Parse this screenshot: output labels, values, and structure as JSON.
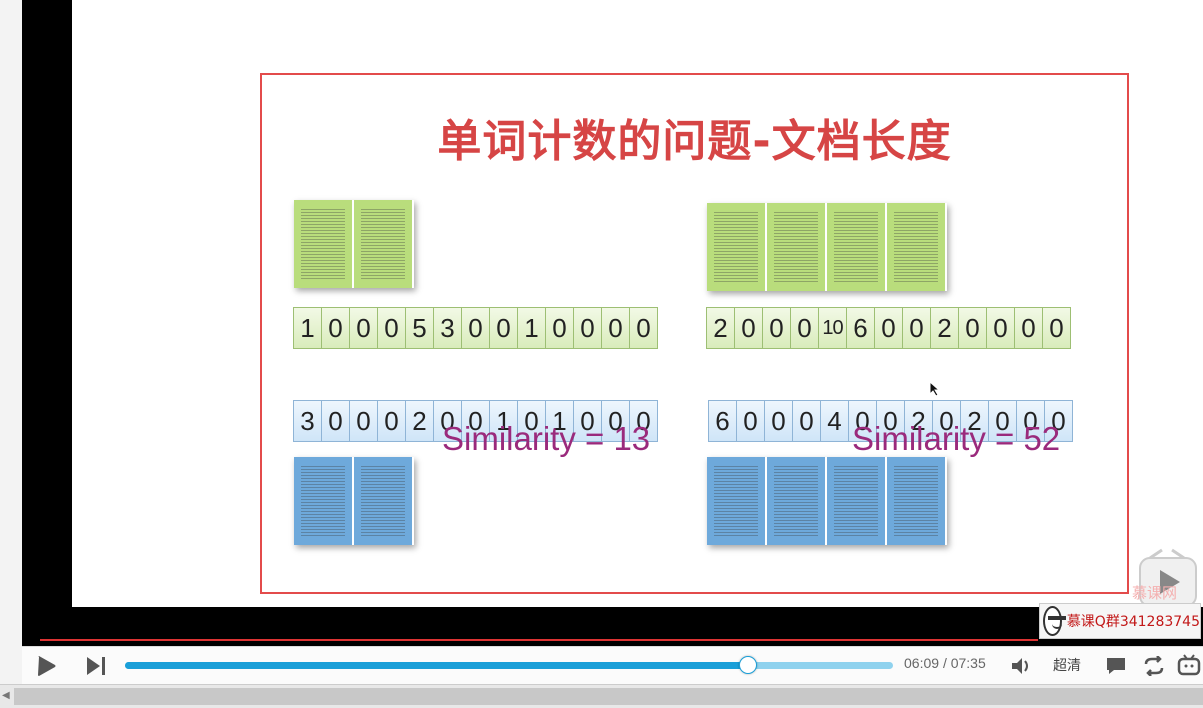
{
  "slide": {
    "title": "单词计数的问题-文档长度",
    "left": {
      "doc_top_vector": [
        "1",
        "0",
        "0",
        "0",
        "5",
        "3",
        "0",
        "0",
        "1",
        "0",
        "0",
        "0",
        "0"
      ],
      "doc_bottom_vector": [
        "3",
        "0",
        "0",
        "0",
        "2",
        "0",
        "0",
        "1",
        "0",
        "1",
        "0",
        "0",
        "0"
      ],
      "similarity": "Similarity = 13"
    },
    "right": {
      "doc_top_vector": [
        "2",
        "0",
        "0",
        "0",
        "10",
        "6",
        "0",
        "0",
        "2",
        "0",
        "0",
        "0",
        "0"
      ],
      "doc_bottom_vector": [
        "6",
        "0",
        "0",
        "0",
        "4",
        "0",
        "0",
        "2",
        "0",
        "2",
        "0",
        "0",
        "0"
      ],
      "similarity": "Similarity = 52"
    }
  },
  "watermark": {
    "brand": "慕课网",
    "qq_group": "慕课Q群341283745"
  },
  "player": {
    "progress": 0.81,
    "current_time": "06:09",
    "separator": "/",
    "total_time": "07:35",
    "quality": "超清"
  },
  "icons": {
    "play": "play-icon",
    "next": "next-icon",
    "volume": "volume-icon",
    "danmaku": "comment-icon",
    "loop": "loop-icon",
    "bilibili": "tv-icon"
  }
}
